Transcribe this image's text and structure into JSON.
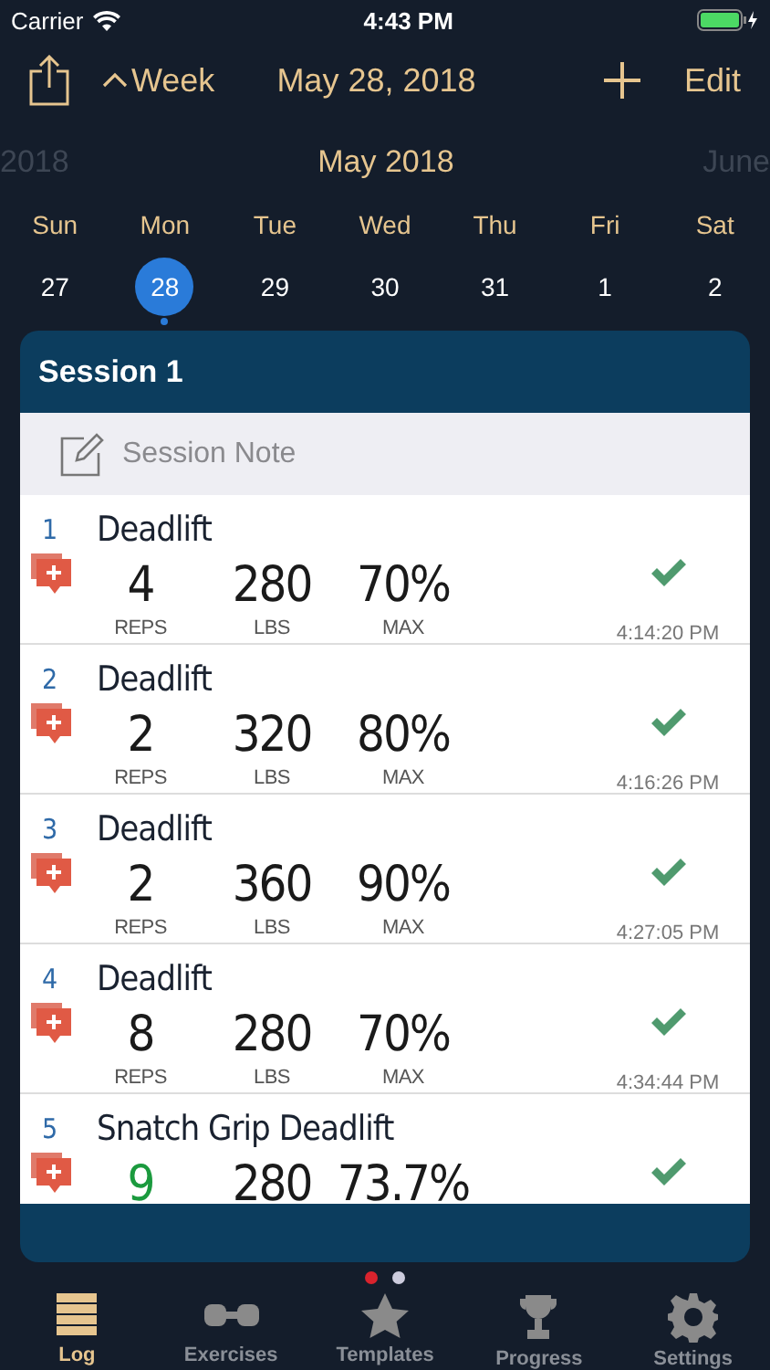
{
  "status_bar": {
    "carrier": "Carrier",
    "time": "4:43 PM"
  },
  "nav": {
    "view_toggle": "Week",
    "title": "May 28, 2018",
    "edit": "Edit"
  },
  "month_strip": {
    "previous": "2018",
    "current": "May 2018",
    "next": "June"
  },
  "weekdays": [
    "Sun",
    "Mon",
    "Tue",
    "Wed",
    "Thu",
    "Fri",
    "Sat"
  ],
  "dates": [
    {
      "label": "27",
      "selected": false,
      "marked": false
    },
    {
      "label": "28",
      "selected": true,
      "marked": true
    },
    {
      "label": "29",
      "selected": false,
      "marked": false
    },
    {
      "label": "30",
      "selected": false,
      "marked": false
    },
    {
      "label": "31",
      "selected": false,
      "marked": false
    },
    {
      "label": "1",
      "selected": false,
      "marked": false
    },
    {
      "label": "2",
      "selected": false,
      "marked": false
    }
  ],
  "session": {
    "title": "Session 1",
    "note_placeholder": "Session Note",
    "sets": [
      {
        "index": "1",
        "exercise": "Deadlift",
        "reps": "4",
        "reps_record": false,
        "weight": "280",
        "percent": "70%",
        "reps_unit": "REPS",
        "weight_unit": "LBS",
        "percent_unit": "MAX",
        "done": true,
        "time": "4:14:20 PM"
      },
      {
        "index": "2",
        "exercise": "Deadlift",
        "reps": "2",
        "reps_record": false,
        "weight": "320",
        "percent": "80%",
        "reps_unit": "REPS",
        "weight_unit": "LBS",
        "percent_unit": "MAX",
        "done": true,
        "time": "4:16:26 PM"
      },
      {
        "index": "3",
        "exercise": "Deadlift",
        "reps": "2",
        "reps_record": false,
        "weight": "360",
        "percent": "90%",
        "reps_unit": "REPS",
        "weight_unit": "LBS",
        "percent_unit": "MAX",
        "done": true,
        "time": "4:27:05 PM"
      },
      {
        "index": "4",
        "exercise": "Deadlift",
        "reps": "8",
        "reps_record": false,
        "weight": "280",
        "percent": "70%",
        "reps_unit": "REPS",
        "weight_unit": "LBS",
        "percent_unit": "MAX",
        "done": true,
        "time": "4:34:44 PM"
      },
      {
        "index": "5",
        "exercise": "Snatch Grip Deadlift",
        "reps": "9",
        "reps_record": true,
        "weight": "280",
        "percent": "73.7%",
        "done": true
      }
    ]
  },
  "pages": [
    {
      "selected": true
    },
    {
      "selected": false
    }
  ],
  "tabs": [
    {
      "label": "Log",
      "kind": "log",
      "selected": true
    },
    {
      "label": "Exercises",
      "kind": "exercises",
      "selected": false
    },
    {
      "label": "Templates",
      "kind": "templates",
      "selected": false
    },
    {
      "label": "Progress",
      "kind": "progress",
      "selected": false
    },
    {
      "label": "Settings",
      "kind": "settings",
      "selected": false
    }
  ]
}
